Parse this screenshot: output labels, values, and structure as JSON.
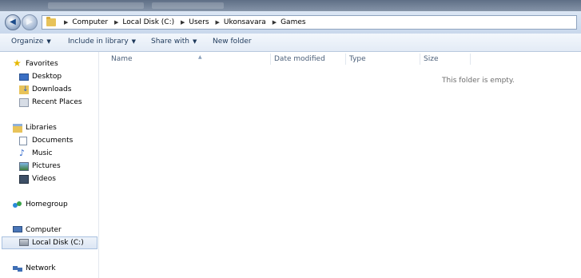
{
  "address": {
    "crumbs": [
      "Computer",
      "Local Disk (C:)",
      "Users",
      "Ukonsavara",
      "Games"
    ]
  },
  "toolbar": {
    "organize": "Organize",
    "include": "Include in library",
    "share": "Share with",
    "new_folder": "New folder"
  },
  "sidebar": {
    "favorites": "Favorites",
    "desktop": "Desktop",
    "downloads": "Downloads",
    "recent": "Recent Places",
    "libraries": "Libraries",
    "documents": "Documents",
    "music": "Music",
    "pictures": "Pictures",
    "videos": "Videos",
    "homegroup": "Homegroup",
    "computer": "Computer",
    "local_disk": "Local Disk (C:)",
    "network": "Network"
  },
  "columns": {
    "name": "Name",
    "date": "Date modified",
    "type": "Type",
    "size": "Size"
  },
  "empty_message": "This folder is empty.",
  "colors": {
    "accent": "#1e395b",
    "selection": "#dce6f4",
    "folder": "#e8c35a"
  }
}
